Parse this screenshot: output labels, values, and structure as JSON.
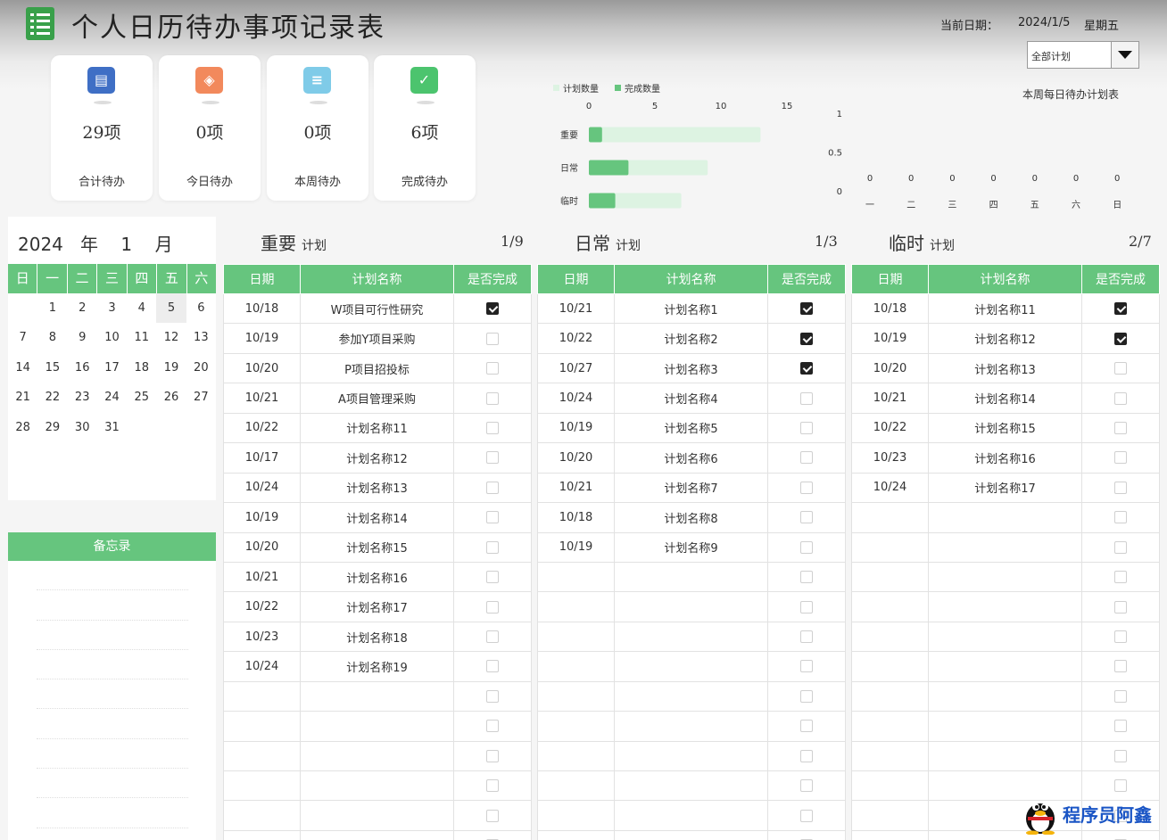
{
  "header": {
    "title": "个人日历待办事项记录表",
    "date_label": "当前日期：",
    "date_value": "2024/1/5",
    "weekday": "星期五",
    "filter_selected": "全部计划"
  },
  "colors": {
    "accent": "#66c57e",
    "accent_light": "#ddf3e2",
    "logo": "#39a04a"
  },
  "cards": [
    {
      "icon": "document-icon",
      "color": "#3f6fc5",
      "value": "29项",
      "label": "合计待办"
    },
    {
      "icon": "layers-icon",
      "color": "#f2895c",
      "value": "0项",
      "label": "今日待办"
    },
    {
      "icon": "database-icon",
      "color": "#7fcbe8",
      "value": "0项",
      "label": "本周待办"
    },
    {
      "icon": "check-icon",
      "color": "#4cc46e",
      "value": "6项",
      "label": "完成待办"
    }
  ],
  "chart_data": [
    {
      "type": "bar",
      "orientation": "horizontal",
      "title": "",
      "categories": [
        "重要",
        "日常",
        "临时"
      ],
      "series": [
        {
          "name": "计划数量",
          "values": [
            13,
            9,
            7
          ],
          "color": "#ddf3e2"
        },
        {
          "name": "完成数量",
          "values": [
            1,
            3,
            2
          ],
          "color": "#66c57e"
        }
      ],
      "xticks": [
        "0",
        "5",
        "10",
        "15"
      ],
      "xlim": [
        0,
        15
      ],
      "legend": "top-left",
      "grid": false
    },
    {
      "type": "bar",
      "title": "本周每日待办计划表",
      "categories": [
        "一",
        "二",
        "三",
        "四",
        "五",
        "六",
        "日"
      ],
      "values": [
        0,
        0,
        0,
        0,
        0,
        0,
        0
      ],
      "data_labels": [
        "0",
        "0",
        "0",
        "0",
        "0",
        "0",
        "0"
      ],
      "yticks": [
        "1",
        "0.5",
        "0"
      ],
      "ylim": [
        0,
        1
      ],
      "grid": false
    }
  ],
  "calendar": {
    "year": "2024",
    "year_suffix": "年",
    "month": "1",
    "month_suffix": "月",
    "weekdays": [
      "日",
      "一",
      "二",
      "三",
      "四",
      "五",
      "六"
    ],
    "weeks": [
      [
        "",
        "1",
        "2",
        "3",
        "4",
        "5",
        "6"
      ],
      [
        "7",
        "8",
        "9",
        "10",
        "11",
        "12",
        "13"
      ],
      [
        "14",
        "15",
        "16",
        "17",
        "18",
        "19",
        "20"
      ],
      [
        "21",
        "22",
        "23",
        "24",
        "25",
        "26",
        "27"
      ],
      [
        "28",
        "29",
        "30",
        "31",
        "",
        "",
        ""
      ]
    ],
    "today": "5"
  },
  "memo": {
    "title": "备忘录"
  },
  "sections": [
    {
      "title": "重要",
      "suffix": "计划",
      "page": "1/9",
      "headers": [
        "日期",
        "计划名称",
        "是否完成"
      ],
      "rows": [
        {
          "date": "10/18",
          "name": "W项目可行性研究",
          "done": true
        },
        {
          "date": "10/19",
          "name": "参加Y项目采购",
          "done": false
        },
        {
          "date": "10/20",
          "name": "P项目招投标",
          "done": false
        },
        {
          "date": "10/21",
          "name": "A项目管理采购",
          "done": false
        },
        {
          "date": "10/22",
          "name": "计划名称11",
          "done": false
        },
        {
          "date": "10/17",
          "name": "计划名称12",
          "done": false
        },
        {
          "date": "10/24",
          "name": "计划名称13",
          "done": false
        },
        {
          "date": "10/19",
          "name": "计划名称14",
          "done": false
        },
        {
          "date": "10/20",
          "name": "计划名称15",
          "done": false
        },
        {
          "date": "10/21",
          "name": "计划名称16",
          "done": false
        },
        {
          "date": "10/22",
          "name": "计划名称17",
          "done": false
        },
        {
          "date": "10/23",
          "name": "计划名称18",
          "done": false
        },
        {
          "date": "10/24",
          "name": "计划名称19",
          "done": false
        }
      ]
    },
    {
      "title": "日常",
      "suffix": "计划",
      "page": "1/3",
      "headers": [
        "日期",
        "计划名称",
        "是否完成"
      ],
      "rows": [
        {
          "date": "10/21",
          "name": "计划名称1",
          "done": true
        },
        {
          "date": "10/22",
          "name": "计划名称2",
          "done": true
        },
        {
          "date": "10/27",
          "name": "计划名称3",
          "done": true
        },
        {
          "date": "10/24",
          "name": "计划名称4",
          "done": false
        },
        {
          "date": "10/19",
          "name": "计划名称5",
          "done": false
        },
        {
          "date": "10/20",
          "name": "计划名称6",
          "done": false
        },
        {
          "date": "10/21",
          "name": "计划名称7",
          "done": false
        },
        {
          "date": "10/18",
          "name": "计划名称8",
          "done": false
        },
        {
          "date": "10/19",
          "name": "计划名称9",
          "done": false
        }
      ]
    },
    {
      "title": "临时",
      "suffix": "计划",
      "page": "2/7",
      "headers": [
        "日期",
        "计划名称",
        "是否完成"
      ],
      "rows": [
        {
          "date": "10/18",
          "name": "计划名称11",
          "done": true
        },
        {
          "date": "10/19",
          "name": "计划名称12",
          "done": true
        },
        {
          "date": "10/20",
          "name": "计划名称13",
          "done": false
        },
        {
          "date": "10/21",
          "name": "计划名称14",
          "done": false
        },
        {
          "date": "10/22",
          "name": "计划名称15",
          "done": false
        },
        {
          "date": "10/23",
          "name": "计划名称16",
          "done": false
        },
        {
          "date": "10/24",
          "name": "计划名称17",
          "done": false
        }
      ]
    }
  ],
  "watermark": {
    "text": "程序员阿鑫"
  }
}
